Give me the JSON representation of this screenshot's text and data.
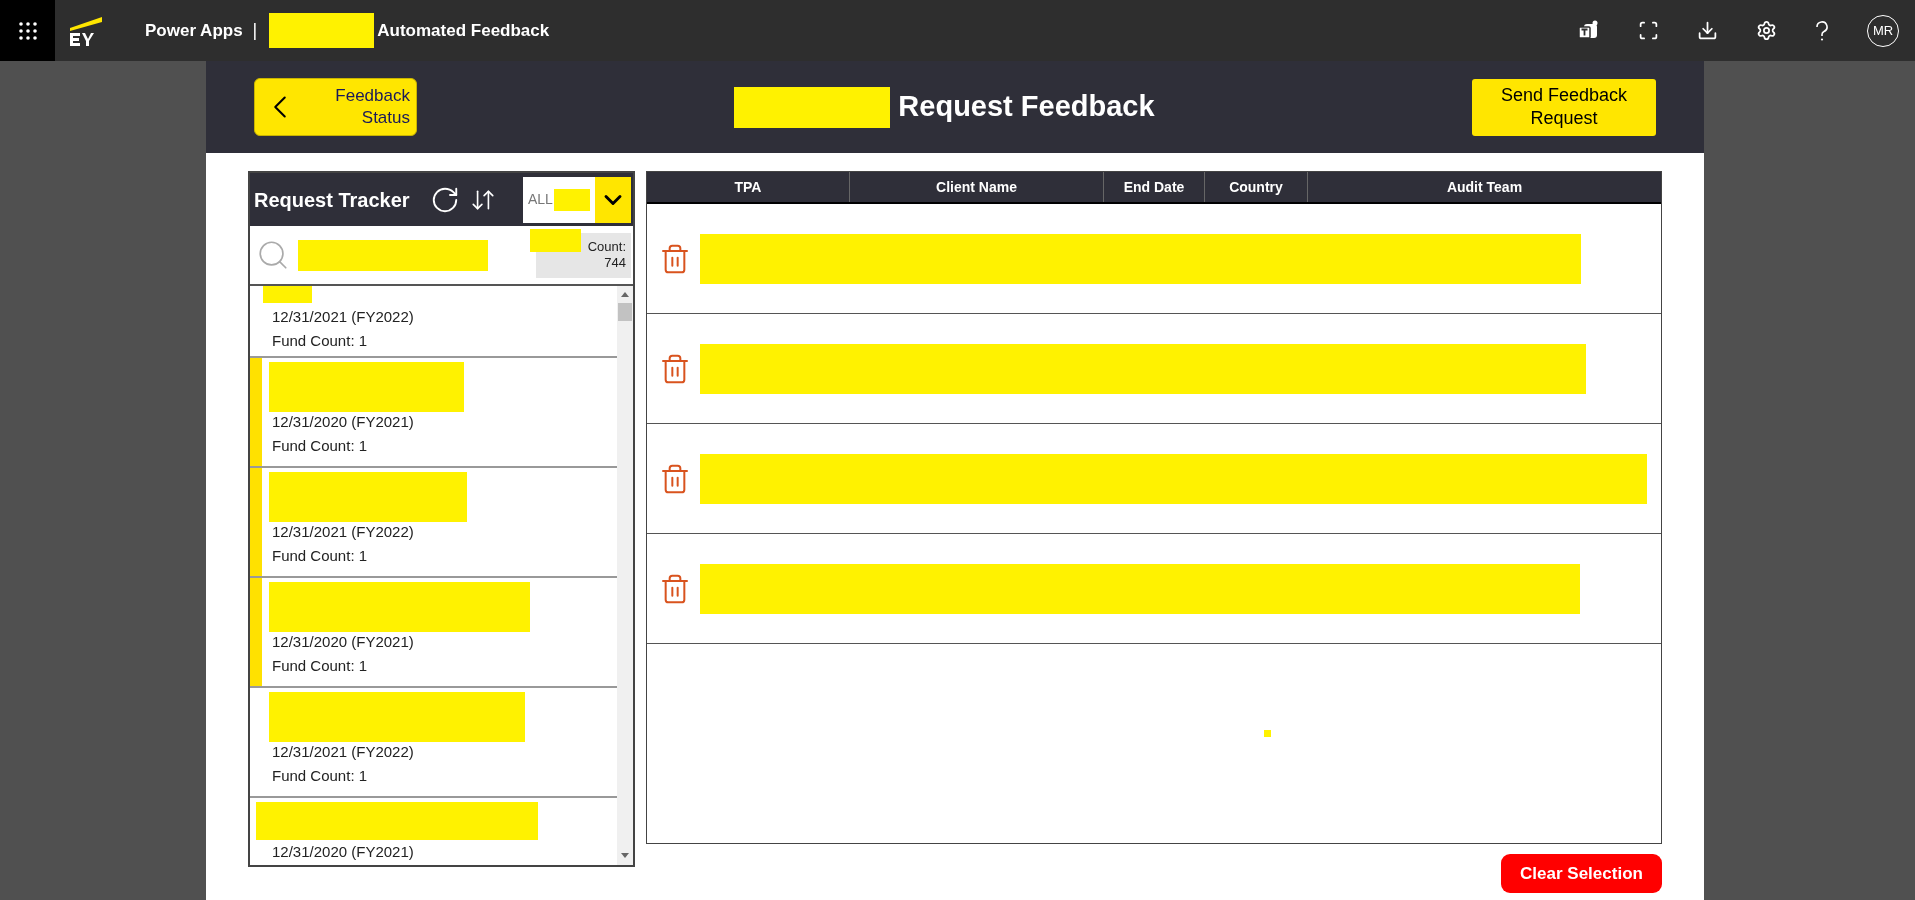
{
  "top_bar": {
    "app_name": "Power Apps",
    "separator": "|",
    "title": "Automated Feedback",
    "avatar": "MR"
  },
  "header": {
    "back_button": "Feedback Status",
    "title": "Request Feedback",
    "send_button": "Send Feedback Request"
  },
  "tracker": {
    "title": "Request Tracker",
    "filter": "ALL",
    "count_label": "Count:",
    "count": "744",
    "items": [
      {
        "lines": [
          "12/31/2021 (FY2022)",
          "Fund Count: 1"
        ],
        "selected": false
      },
      {
        "lines": [
          "12/31/2020 (FY2021)",
          "Fund Count: 1"
        ],
        "selected": true
      },
      {
        "lines": [
          "12/31/2021 (FY2022)",
          "Fund Count: 1"
        ],
        "selected": true
      },
      {
        "lines": [
          "12/31/2020 (FY2021)",
          "Fund Count: 1"
        ],
        "selected": true
      },
      {
        "lines": [
          "12/31/2021 (FY2022)",
          "Fund Count: 1"
        ],
        "selected": false
      },
      {
        "lines": [
          "12/31/2020 (FY2021)"
        ],
        "selected": false
      }
    ]
  },
  "table": {
    "columns": [
      "TPA",
      "Client Name",
      "End Date",
      "Country",
      "Audit Team"
    ],
    "rows": [
      {
        "kind": "redacted"
      },
      {
        "kind": "redacted"
      },
      {
        "kind": "redacted"
      },
      {
        "kind": "redacted"
      }
    ]
  },
  "clear_button": "Clear Selection"
}
